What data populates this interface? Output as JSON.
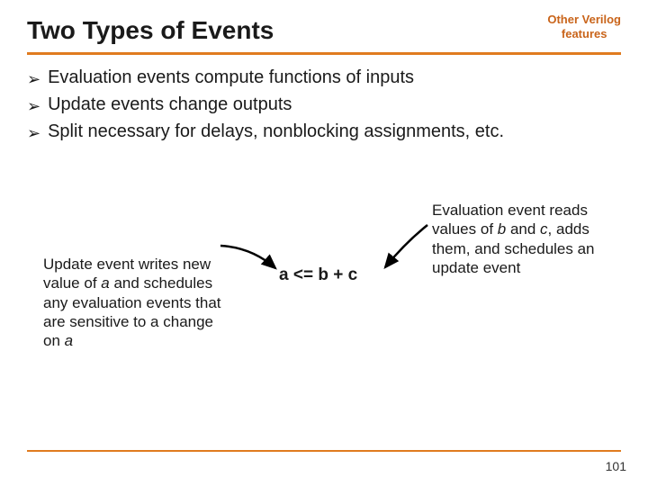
{
  "header": {
    "title": "Two Types of Events",
    "corner_line1": "Other Verilog",
    "corner_line2": "features"
  },
  "bullets": [
    "Evaluation events compute functions of inputs",
    "Update events change outputs",
    "Split necessary for delays, nonblocking assignments, etc."
  ],
  "diagram": {
    "expression": "a <= b + c",
    "left_note_html": "Update event writes new value of <em class='ital'>a</em> and schedules any evaluation events that are sensitive to a change on <em class='ital'>a</em>",
    "right_note_html": "Evaluation event reads values of <em class='ital'>b</em> and <em class='ital'>c</em>, adds them, and schedules an update event"
  },
  "page_number": "101"
}
